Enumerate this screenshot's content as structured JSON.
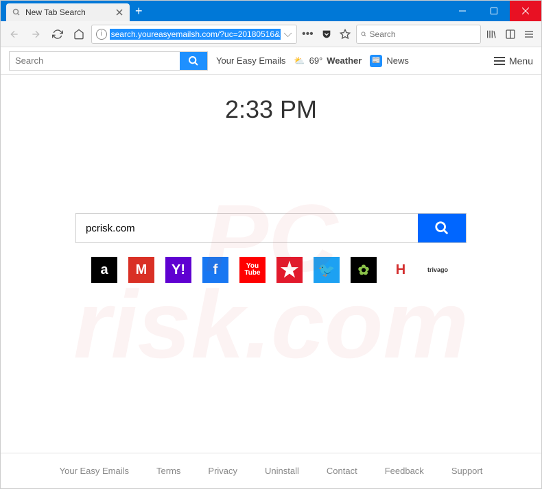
{
  "window": {
    "tab_title": "New Tab Search",
    "url": "search.youreasyemailsh.com/?uc=20180516&",
    "addr_search_placeholder": "Search"
  },
  "toolbar": {
    "search_placeholder": "Search",
    "emails_label": "Your Easy Emails",
    "weather_temp": "69°",
    "weather_label": "Weather",
    "news_label": "News",
    "menu_label": "Menu"
  },
  "page": {
    "clock": "2:33 PM",
    "search_value": "pcrisk.com"
  },
  "shortcuts": [
    {
      "name": "amazon",
      "glyph": "a"
    },
    {
      "name": "gmail",
      "glyph": "M"
    },
    {
      "name": "yahoo",
      "glyph": "Y!"
    },
    {
      "name": "facebook",
      "glyph": "f"
    },
    {
      "name": "youtube",
      "glyph": "You\nTube"
    },
    {
      "name": "macys",
      "glyph": "★"
    },
    {
      "name": "twitter",
      "glyph": "🐦"
    },
    {
      "name": "ancestry",
      "glyph": "✿"
    },
    {
      "name": "hotels",
      "glyph": "H"
    },
    {
      "name": "trivago",
      "glyph": "trivago"
    }
  ],
  "footer": {
    "links": [
      "Your Easy Emails",
      "Terms",
      "Privacy",
      "Uninstall",
      "Contact",
      "Feedback",
      "Support"
    ]
  },
  "watermark": "PC\nrisk.com"
}
